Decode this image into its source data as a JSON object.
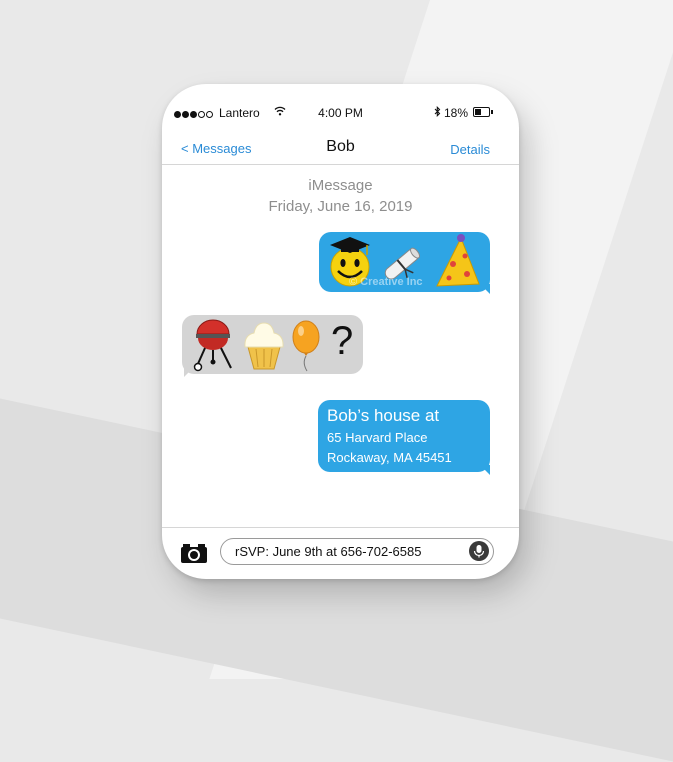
{
  "status_bar": {
    "signal_bars": 3,
    "signal_total": 5,
    "carrier": "Lantero",
    "time": "4:00 PM",
    "battery": "18%",
    "wifi_icon": "wifi-icon",
    "bluetooth_icon": "bluetooth-icon",
    "battery_icon": "battery-icon"
  },
  "nav": {
    "back_label": "< Messages",
    "contact_name": "Bob",
    "details_label": "Details"
  },
  "thread": {
    "service": "iMessage",
    "date": "Friday, June 16, 2019"
  },
  "messages": [
    {
      "direction": "outgoing",
      "content": [
        "smiley-graduation-cap-emoji",
        "diploma-emoji",
        "party-hat-emoji"
      ],
      "watermark": "© Creative Inc"
    },
    {
      "direction": "incoming",
      "content": [
        "grill-emoji",
        "cupcake-emoji",
        "balloon-emoji"
      ],
      "text": "?"
    },
    {
      "direction": "outgoing",
      "lines": [
        "Bob’s house at",
        "65 Harvard Place",
        "Rockaway, MA 45451"
      ]
    }
  ],
  "input": {
    "value": "rSVP: June 9th at 656-702-6585",
    "camera_icon": "camera-icon",
    "mic_icon": "microphone-icon"
  },
  "colors": {
    "outgoing_bubble": "#2ea5e4",
    "incoming_bubble": "#d4d4d4",
    "link": "#2a8bd6"
  }
}
